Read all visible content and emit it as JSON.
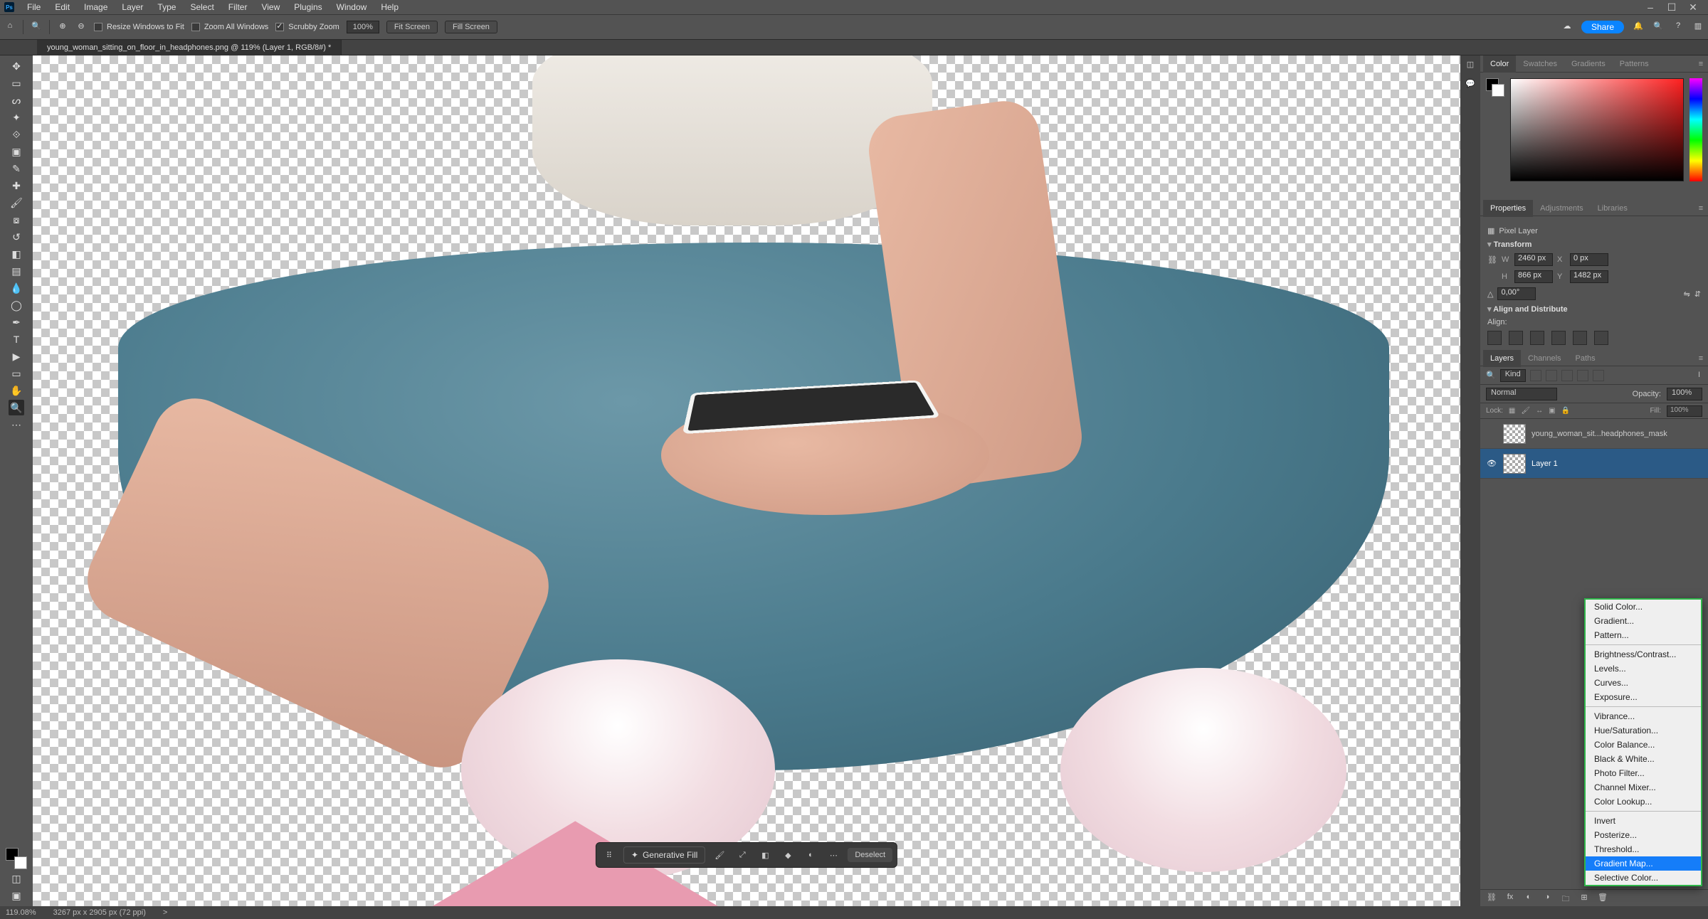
{
  "menubar": {
    "items": [
      "File",
      "Edit",
      "Image",
      "Layer",
      "Type",
      "Select",
      "Filter",
      "View",
      "Plugins",
      "Window",
      "Help"
    ]
  },
  "window": {
    "minimize": "–",
    "maximize": "☐",
    "close": "✕"
  },
  "options": {
    "resize_windows": "Resize Windows to Fit",
    "zoom_all": "Zoom All Windows",
    "scrubby": "Scrubby Zoom",
    "zoom_pct": "100%",
    "fit_screen": "Fit Screen",
    "fill_screen": "Fill Screen",
    "share": "Share"
  },
  "tab": {
    "title": "young_woman_sitting_on_floor_in_headphones.png @ 119% (Layer 1, RGB/8#) *"
  },
  "ctxbar": {
    "gen": "Generative Fill",
    "deselect": "Deselect"
  },
  "panel_tabs": {
    "color": "Color",
    "swatches": "Swatches",
    "gradients": "Gradients",
    "patterns": "Patterns",
    "properties": "Properties",
    "adjustments": "Adjustments",
    "libraries": "Libraries",
    "layers": "Layers",
    "channels": "Channels",
    "paths": "Paths"
  },
  "properties": {
    "kind": "Pixel Layer",
    "transform": "Transform",
    "W": "2460 px",
    "H": "866 px",
    "X": "0 px",
    "Y": "1482 px",
    "angle": "0,00°",
    "align": "Align and Distribute",
    "align_lbl": "Align:"
  },
  "layers_panel": {
    "kind_filter": "Kind",
    "blend": "Normal",
    "opacity_lbl": "Opacity:",
    "opacity": "100%",
    "lock_lbl": "Lock:",
    "fill_lbl": "Fill:",
    "fill": "100%",
    "layer0": "young_woman_sit...headphones_mask",
    "layer1": "Layer 1"
  },
  "popup": {
    "solid": "Solid Color...",
    "gradient": "Gradient...",
    "pattern": "Pattern...",
    "bc": "Brightness/Contrast...",
    "levels": "Levels...",
    "curves": "Curves...",
    "exposure": "Exposure...",
    "vibrance": "Vibrance...",
    "hsl": "Hue/Saturation...",
    "cb": "Color Balance...",
    "bw": "Black & White...",
    "pf": "Photo Filter...",
    "cm": "Channel Mixer...",
    "cl": "Color Lookup...",
    "invert": "Invert",
    "posterize": "Posterize...",
    "threshold": "Threshold...",
    "gm": "Gradient Map...",
    "sc": "Selective Color..."
  },
  "status": {
    "zoom": "119.08%",
    "docinfo": "3267 px x 2905 px (72 ppi)",
    "arrow": ">"
  }
}
